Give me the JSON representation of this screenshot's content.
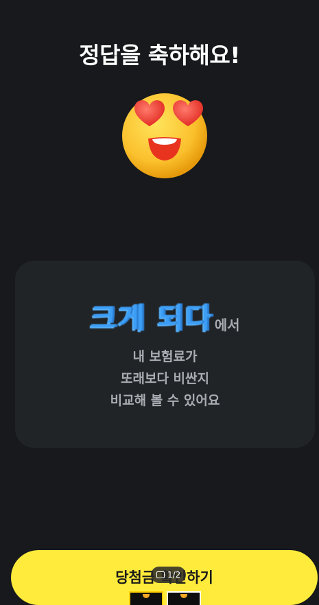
{
  "header": {
    "title": "정답을 축하해요!"
  },
  "emoji": {
    "icon": "heart-eyes-emoji-icon"
  },
  "card": {
    "brand_name": "크게 되다",
    "brand_suffix": "에서",
    "lines": [
      "내 보험료가",
      "또래보다 비싼지",
      "비교해 볼 수 있어요"
    ]
  },
  "cta": {
    "label": "당첨금 확인하기"
  },
  "pager": {
    "text": "1/2"
  },
  "colors": {
    "background": "#17191c",
    "card": "#212427",
    "accent": "#ffeb3b",
    "brand": "#3d9ef5"
  }
}
